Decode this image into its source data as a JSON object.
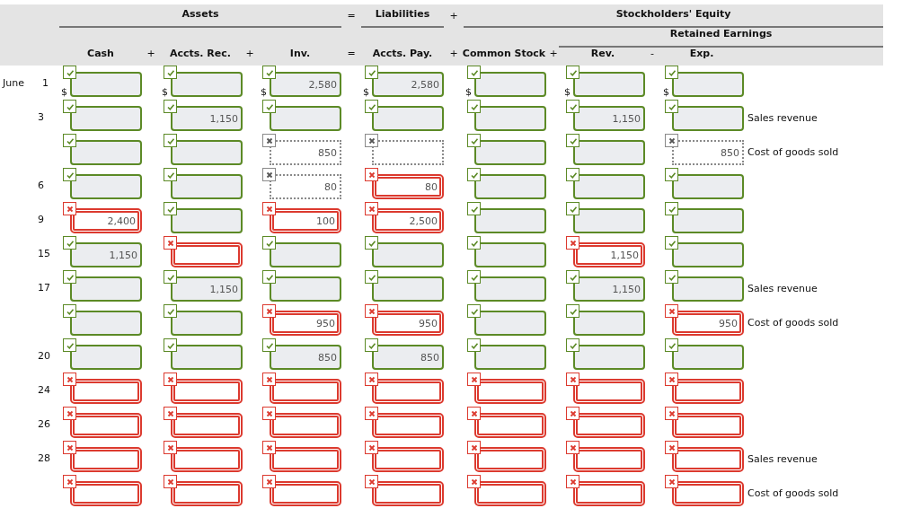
{
  "header": {
    "groups": [
      {
        "kind": "group",
        "label": "Assets"
      },
      {
        "kind": "operator",
        "label": "="
      },
      {
        "kind": "group",
        "label": "Liabilities"
      },
      {
        "kind": "operator",
        "label": "+"
      },
      {
        "kind": "group",
        "label": "Stockholders' Equity"
      }
    ],
    "subgroup": {
      "label": "Retained Earnings"
    },
    "columns": [
      "Cash",
      "Accts. Rec.",
      "Inv.",
      "Accts. Pay.",
      "Common Stock",
      "Rev.",
      "Exp."
    ],
    "operators": [
      "+",
      "+",
      "=",
      "+",
      "+",
      "-"
    ]
  },
  "rows": [
    {
      "month": "June",
      "day": "1",
      "cells": [
        {
          "prefix": "$",
          "answered": true,
          "correct": true
        },
        {
          "prefix": "$",
          "answered": true,
          "correct": true
        },
        {
          "prefix": "$",
          "answered": true,
          "correct": true,
          "value": "2,580"
        },
        {
          "prefix": "$",
          "answered": true,
          "correct": true,
          "value": "2,580"
        },
        {
          "prefix": "$",
          "answered": true,
          "correct": true
        },
        {
          "prefix": "$",
          "answered": true,
          "correct": true
        },
        {
          "prefix": "$",
          "answered": true,
          "correct": true
        }
      ]
    },
    {
      "day": "3",
      "note": "Sales revenue",
      "cells": [
        {
          "answered": true,
          "correct": true
        },
        {
          "answered": true,
          "correct": true,
          "value": "1,150"
        },
        {
          "answered": true,
          "correct": true
        },
        {
          "answered": true,
          "correct": true
        },
        {
          "answered": true,
          "correct": true
        },
        {
          "answered": true,
          "correct": true,
          "value": "1,150"
        },
        {
          "answered": true,
          "correct": true
        }
      ]
    },
    {
      "note": "Cost of goods sold",
      "cells": [
        {
          "answered": true,
          "correct": true
        },
        {
          "answered": true,
          "correct": true
        },
        {
          "answered": false,
          "value": "850"
        },
        {
          "answered": false
        },
        {
          "answered": true,
          "correct": true
        },
        {
          "answered": true,
          "correct": true
        },
        {
          "answered": false,
          "value": "850"
        }
      ]
    },
    {
      "day": "6",
      "cells": [
        {
          "answered": true,
          "correct": true
        },
        {
          "answered": true,
          "correct": true
        },
        {
          "answered": false,
          "value": "80"
        },
        {
          "answered": true,
          "correct": false,
          "value": "80"
        },
        {
          "answered": true,
          "correct": true
        },
        {
          "answered": true,
          "correct": true
        },
        {
          "answered": true,
          "correct": true
        }
      ]
    },
    {
      "day": "9",
      "cells": [
        {
          "answered": true,
          "correct": false,
          "value": "2,400"
        },
        {
          "answered": true,
          "correct": true
        },
        {
          "answered": true,
          "correct": false,
          "value": "100"
        },
        {
          "answered": true,
          "correct": false,
          "value": "2,500"
        },
        {
          "answered": true,
          "correct": true
        },
        {
          "answered": true,
          "correct": true
        },
        {
          "answered": true,
          "correct": true
        }
      ]
    },
    {
      "day": "15",
      "cells": [
        {
          "answered": true,
          "correct": true,
          "value": "1,150"
        },
        {
          "answered": true,
          "correct": false
        },
        {
          "answered": true,
          "correct": true
        },
        {
          "answered": true,
          "correct": true
        },
        {
          "answered": true,
          "correct": true
        },
        {
          "answered": true,
          "correct": false,
          "value": "1,150"
        },
        {
          "answered": true,
          "correct": true
        }
      ]
    },
    {
      "day": "17",
      "note": "Sales revenue",
      "cells": [
        {
          "answered": true,
          "correct": true
        },
        {
          "answered": true,
          "correct": true,
          "value": "1,150"
        },
        {
          "answered": true,
          "correct": true
        },
        {
          "answered": true,
          "correct": true
        },
        {
          "answered": true,
          "correct": true
        },
        {
          "answered": true,
          "correct": true,
          "value": "1,150"
        },
        {
          "answered": true,
          "correct": true
        }
      ]
    },
    {
      "note": "Cost of goods sold",
      "cells": [
        {
          "answered": true,
          "correct": true
        },
        {
          "answered": true,
          "correct": true
        },
        {
          "answered": true,
          "correct": false,
          "value": "950"
        },
        {
          "answered": true,
          "correct": false,
          "value": "950"
        },
        {
          "answered": true,
          "correct": true
        },
        {
          "answered": true,
          "correct": true
        },
        {
          "answered": true,
          "correct": false,
          "value": "950"
        }
      ]
    },
    {
      "day": "20",
      "cells": [
        {
          "answered": true,
          "correct": true
        },
        {
          "answered": true,
          "correct": true
        },
        {
          "answered": true,
          "correct": true,
          "value": "850"
        },
        {
          "answered": true,
          "correct": true,
          "value": "850"
        },
        {
          "answered": true,
          "correct": true
        },
        {
          "answered": true,
          "correct": true
        },
        {
          "answered": true,
          "correct": true
        }
      ]
    },
    {
      "day": "24",
      "cells": [
        {
          "answered": true,
          "correct": false
        },
        {
          "answered": true,
          "correct": false
        },
        {
          "answered": true,
          "correct": false
        },
        {
          "answered": true,
          "correct": false
        },
        {
          "answered": true,
          "correct": false
        },
        {
          "answered": true,
          "correct": false
        },
        {
          "answered": true,
          "correct": false
        }
      ]
    },
    {
      "day": "26",
      "cells": [
        {
          "answered": true,
          "correct": false
        },
        {
          "answered": true,
          "correct": false
        },
        {
          "answered": true,
          "correct": false
        },
        {
          "answered": true,
          "correct": false
        },
        {
          "answered": true,
          "correct": false
        },
        {
          "answered": true,
          "correct": false
        },
        {
          "answered": true,
          "correct": false
        }
      ]
    },
    {
      "day": "28",
      "note": "Sales revenue",
      "cells": [
        {
          "answered": true,
          "correct": false
        },
        {
          "answered": true,
          "correct": false
        },
        {
          "answered": true,
          "correct": false
        },
        {
          "answered": true,
          "correct": false
        },
        {
          "answered": true,
          "correct": false
        },
        {
          "answered": true,
          "correct": false
        },
        {
          "answered": true,
          "correct": false
        }
      ]
    },
    {
      "note": "Cost of goods sold",
      "cells": [
        {
          "answered": true,
          "correct": false
        },
        {
          "answered": true,
          "correct": false
        },
        {
          "answered": true,
          "correct": false
        },
        {
          "answered": true,
          "correct": false
        },
        {
          "answered": true,
          "correct": false
        },
        {
          "answered": true,
          "correct": false
        },
        {
          "answered": true,
          "correct": false
        }
      ]
    }
  ]
}
